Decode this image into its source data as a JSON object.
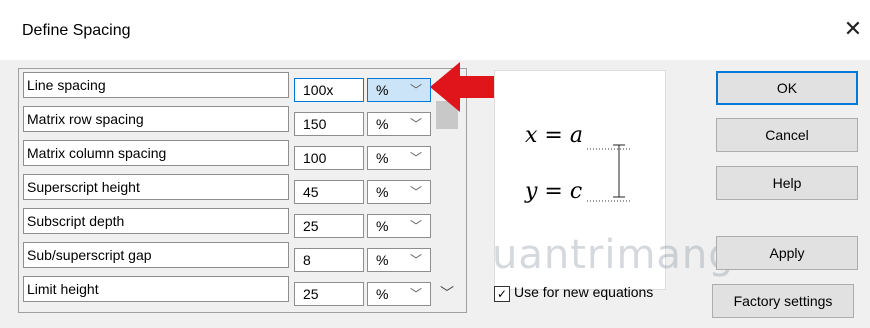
{
  "window": {
    "title": "Define Spacing",
    "close_icon": "close-icon"
  },
  "rows": [
    {
      "label": "Line spacing",
      "value": "100x",
      "unit": "%"
    },
    {
      "label": "Matrix row spacing",
      "value": "150",
      "unit": "%"
    },
    {
      "label": "Matrix column spacing",
      "value": "100",
      "unit": "%"
    },
    {
      "label": "Superscript height",
      "value": "45",
      "unit": "%"
    },
    {
      "label": "Subscript depth",
      "value": "25",
      "unit": "%"
    },
    {
      "label": "Sub/superscript gap",
      "value": "8",
      "unit": "%"
    },
    {
      "label": "Limit height",
      "value": "25",
      "unit": "%"
    }
  ],
  "preview": {
    "eq1": "x = a",
    "eq2": "y = c"
  },
  "checkbox": {
    "label": "Use for new equations",
    "checked": true
  },
  "buttons": {
    "ok": "OK",
    "cancel": "Cancel",
    "help": "Help",
    "apply": "Apply",
    "factory": "Factory settings"
  },
  "watermark": {
    "text": "uantrimang"
  },
  "colors": {
    "accent": "#0078d7",
    "arrow": "#e0141b"
  }
}
